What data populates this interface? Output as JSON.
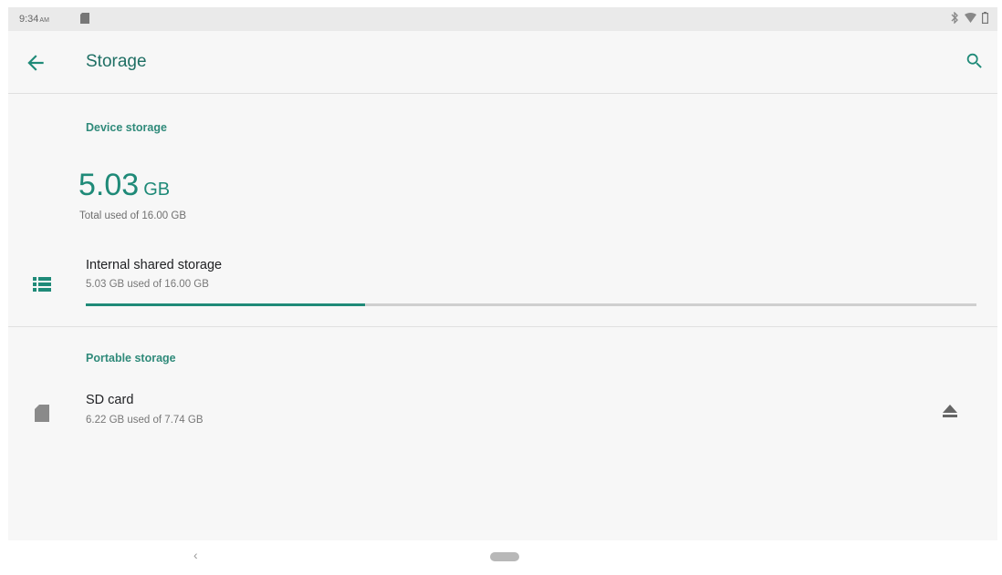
{
  "status_bar": {
    "time": "9:34",
    "ampm": "AM",
    "icons": [
      "sd-card-icon",
      "bluetooth-icon",
      "wifi-icon",
      "battery-icon"
    ]
  },
  "app_bar": {
    "title": "Storage",
    "back_icon": "arrow-left-icon",
    "search_icon": "search-icon"
  },
  "device_storage": {
    "header": "Device storage",
    "used_value": "5.03",
    "used_unit": "GB",
    "total_label": "Total used of 16.00 GB",
    "items": [
      {
        "icon": "storage-list-icon",
        "title": "Internal shared storage",
        "subtitle": "5.03 GB used of 16.00 GB",
        "used_fraction": 0.314
      }
    ]
  },
  "portable_storage": {
    "header": "Portable storage",
    "items": [
      {
        "icon": "sd-card-icon",
        "title": "SD card",
        "subtitle": "6.22 GB used of 7.74 GB",
        "action_icon": "eject-icon"
      }
    ]
  },
  "nav_bar": {
    "back_glyph": "‹",
    "home_icon": "home-pill-icon"
  },
  "colors": {
    "accent": "#1f8a78",
    "title": "#1f6f64",
    "background": "#f7f7f7"
  }
}
